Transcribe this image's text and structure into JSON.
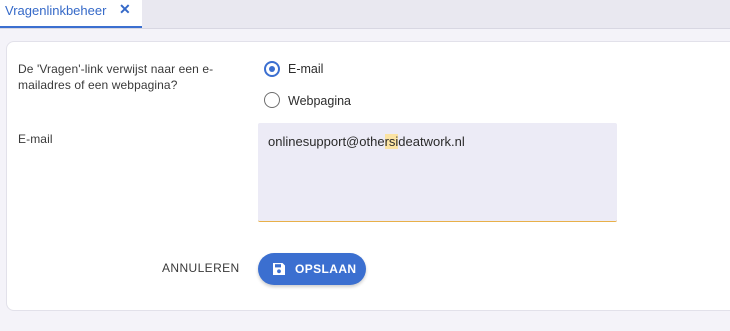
{
  "tab": {
    "title": "Vragenlinkbeheer",
    "close_glyph": "✕"
  },
  "form": {
    "question_label": "De 'Vragen'-link verwijst naar een e-mailadres of een webpagina?",
    "question_label_line1": "De 'Vragen'-link verwijst naar een e-",
    "question_label_line2": "mailadres of een webpagina?",
    "options": [
      {
        "label": "E-mail",
        "selected": true
      },
      {
        "label": "Webpagina",
        "selected": false
      }
    ],
    "email_label": "E-mail",
    "email_value": "onlinesupport@othersideatwork.nl",
    "email_value_parts": [
      "onlinesupport@othe",
      "rsi",
      "deatwork.nl"
    ]
  },
  "actions": {
    "cancel_label": "ANNULEREN",
    "save_label": "OPSLAAN",
    "save_icon": "floppy-disk-icon"
  },
  "colors": {
    "accent": "#3b6fd0",
    "field_bg": "#ecebf6",
    "field_underline": "#e8b04a",
    "highlight": "#fbe3a3"
  }
}
